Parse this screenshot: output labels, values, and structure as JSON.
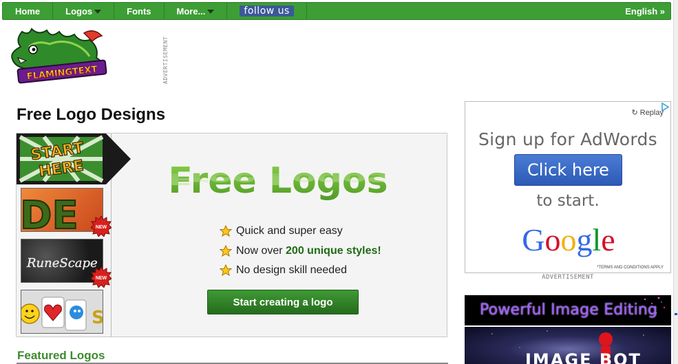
{
  "nav": {
    "items": [
      {
        "label": "Home",
        "dropdown": false
      },
      {
        "label": "Logos",
        "dropdown": true
      },
      {
        "label": "Fonts",
        "dropdown": false
      },
      {
        "label": "More...",
        "dropdown": true
      }
    ],
    "follow_label": "follow us",
    "language": "English »"
  },
  "logo": {
    "text": "FLAMINGTEXT"
  },
  "ads": {
    "vertical_label": "ADVERTISEMENT",
    "label": "ADVERTISEMENT",
    "replay": "Replay",
    "line1": "Sign up for AdWords",
    "button": "Click here",
    "line2": "to start.",
    "brand": "Google",
    "terms": "*TERMS AND CONDITIONS APPLY"
  },
  "main": {
    "title": "Free Logo Designs",
    "start_here": [
      "START",
      "HERE"
    ],
    "headline": "Free Logos",
    "thumbs": [
      {
        "name": "thumb-design",
        "text": "DE",
        "is_new": true
      },
      {
        "name": "thumb-runescape",
        "text": "RuneScape",
        "is_new": true
      },
      {
        "name": "thumb-icons",
        "text": "S",
        "is_new": false
      }
    ],
    "new_badge": "NEW",
    "features": [
      {
        "pre": "Quick and super easy",
        "bold": "",
        "post": ""
      },
      {
        "pre": "Now over ",
        "bold": "200 unique styles!",
        "post": ""
      },
      {
        "pre": "No design skill needed",
        "bold": "",
        "post": ""
      }
    ],
    "cta": "Start creating a logo",
    "featured_title": "Featured Logos"
  },
  "banners": {
    "banner1": "Powerful Image Editing",
    "banner2": "IMAGE BOT"
  },
  "colors": {
    "nav_green": "#3d9e35",
    "accent_green": "#3d8a2e",
    "facebook_blue": "#3b5998",
    "ad_button_blue": "#2d5ab5"
  }
}
